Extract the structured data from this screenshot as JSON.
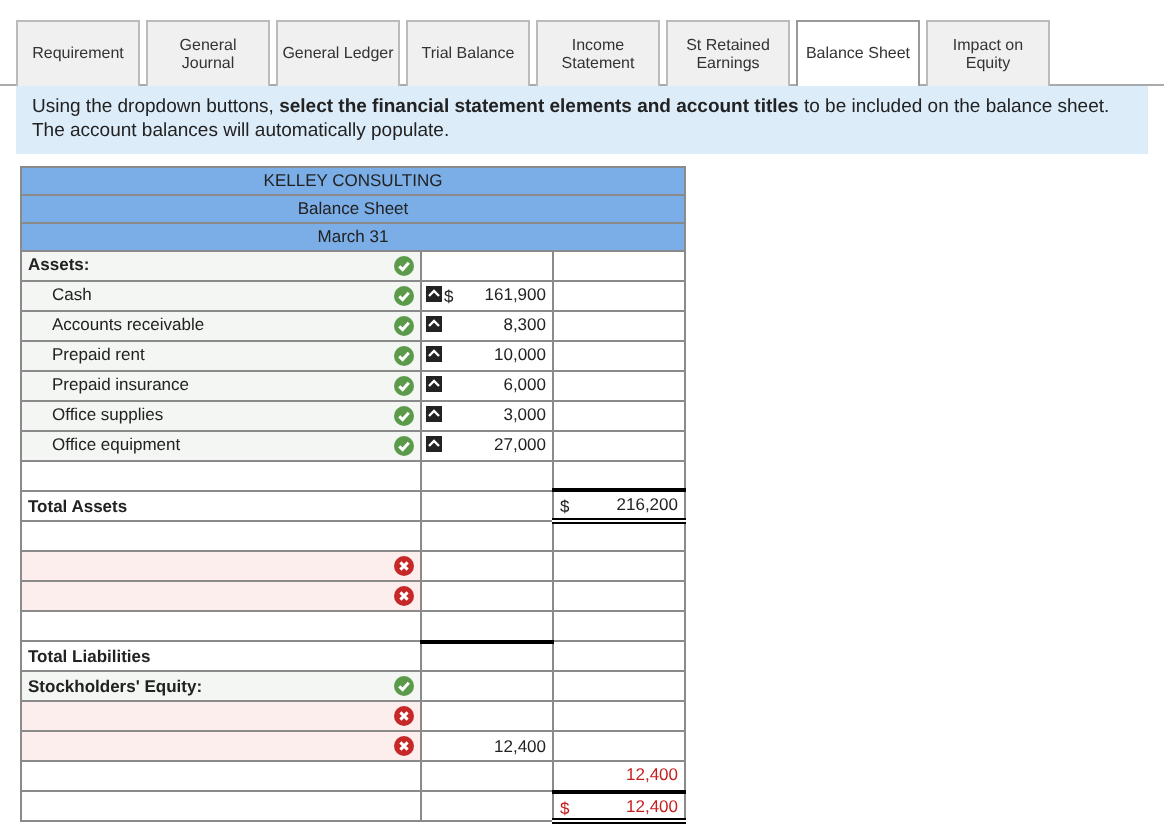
{
  "tabs": [
    {
      "label": "Requirement",
      "selected": false
    },
    {
      "label": "General Journal",
      "selected": false
    },
    {
      "label": "General Ledger",
      "selected": false
    },
    {
      "label": "Trial Balance",
      "selected": false
    },
    {
      "label": "Income Statement",
      "selected": false
    },
    {
      "label": "St Retained Earnings",
      "selected": false
    },
    {
      "label": "Balance Sheet",
      "selected": true
    },
    {
      "label": "Impact on Equity",
      "selected": false
    }
  ],
  "instructions": "Using the dropdown buttons, **select the financial statement elements and account titles** to be included on the balance sheet. The account balances will automatically populate.",
  "sheet": {
    "headings": [
      "KELLEY CONSULTING",
      "Balance Sheet",
      "March 31"
    ],
    "rows": [
      {
        "label": "Assets:",
        "bold": true,
        "indent": false,
        "correct": true,
        "wrong": false
      },
      {
        "label": "Cash",
        "bold": false,
        "indent": true,
        "correct": true,
        "wrong": false,
        "amount": {
          "dollar": "$",
          "text": "161,900",
          "linked": true
        }
      },
      {
        "label": "Accounts receivable",
        "bold": false,
        "indent": true,
        "correct": true,
        "wrong": false,
        "amount": {
          "text": "8,300",
          "linked": true
        }
      },
      {
        "label": "Prepaid rent",
        "bold": false,
        "indent": true,
        "correct": true,
        "wrong": false,
        "amount": {
          "text": "10,000",
          "linked": true
        }
      },
      {
        "label": "Prepaid insurance",
        "bold": false,
        "indent": true,
        "correct": true,
        "wrong": false,
        "amount": {
          "text": "6,000",
          "linked": true
        }
      },
      {
        "label": "Office supplies",
        "bold": false,
        "indent": true,
        "correct": true,
        "wrong": false,
        "amount": {
          "text": "3,000",
          "linked": true
        }
      },
      {
        "label": "Office equipment",
        "bold": false,
        "indent": true,
        "correct": true,
        "wrong": false,
        "amount": {
          "text": "27,000",
          "linked": true
        }
      },
      {
        "correct": false,
        "wrong": false
      },
      {
        "label": "Total Assets",
        "bold": true,
        "indent": false,
        "correct": false,
        "wrong": false,
        "total": {
          "dollar": "$",
          "text": "216,200",
          "rule_above": true,
          "rule_below": true
        }
      },
      {
        "correct": false,
        "wrong": false
      },
      {
        "correct": false,
        "wrong": true
      },
      {
        "correct": false,
        "wrong": true
      },
      {
        "correct": false,
        "wrong": false
      },
      {
        "label": "Total Liabilities",
        "bold": true,
        "indent": false,
        "correct": false,
        "wrong": false,
        "amount": {
          "rule_above": true
        }
      },
      {
        "label": "Stockholders' Equity:",
        "bold": true,
        "indent": false,
        "correct": true,
        "wrong": false
      },
      {
        "correct": false,
        "wrong": true
      },
      {
        "correct": false,
        "wrong": true,
        "amount": {
          "text": "12,400"
        }
      },
      {
        "correct": false,
        "wrong": false,
        "total": {
          "text": "12,400",
          "red": true
        }
      },
      {
        "correct": false,
        "wrong": false,
        "total": {
          "dollar": "$",
          "text": "12,400",
          "red": true,
          "rule_above": true,
          "rule_below": true
        }
      }
    ]
  }
}
